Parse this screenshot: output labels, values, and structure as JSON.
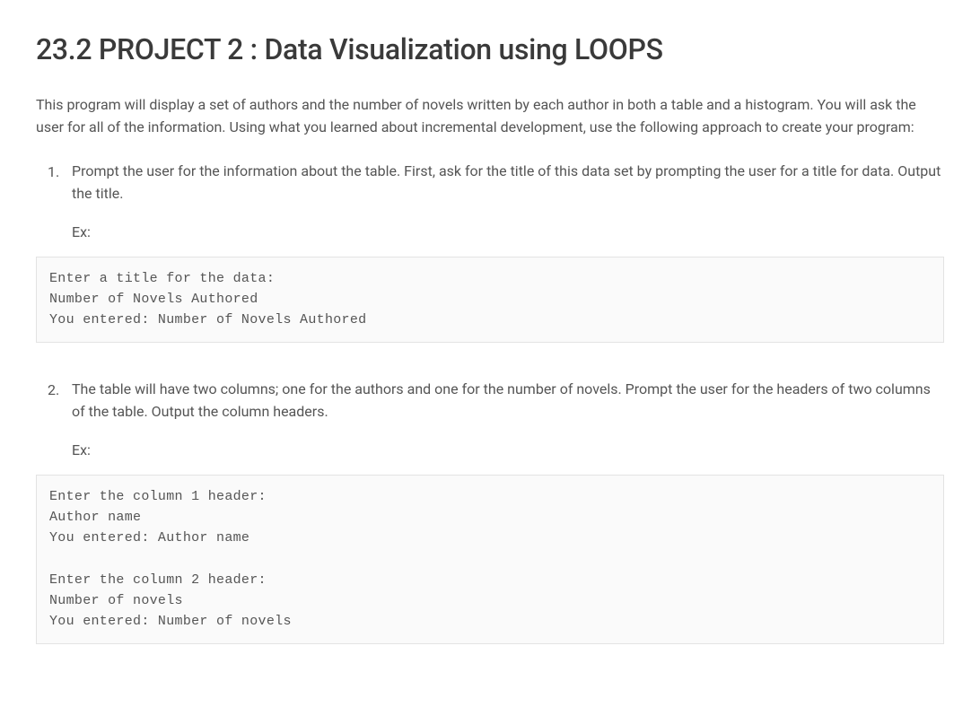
{
  "heading": "23.2 PROJECT 2 : Data Visualization using LOOPS",
  "intro": "This program will display a set of authors and the number of novels written by each author in both a table and a histogram. You will ask the user for all of the information. Using what you learned about incremental development, use the following approach to create your program:",
  "steps": [
    {
      "text": "Prompt the user for the information about the table. First, ask for the title of this data set by prompting the user for a title for data. Output the title.",
      "example_label": "Ex:",
      "code": "Enter a title for the data:\nNumber of Novels Authored\nYou entered: Number of Novels Authored"
    },
    {
      "text": "The table will have two columns; one for the authors and one for the number of novels. Prompt the user for the headers of two columns of the table. Output the column headers.",
      "example_label": "Ex:",
      "code": "Enter the column 1 header:\nAuthor name\nYou entered: Author name\n\nEnter the column 2 header:\nNumber of novels\nYou entered: Number of novels"
    }
  ]
}
